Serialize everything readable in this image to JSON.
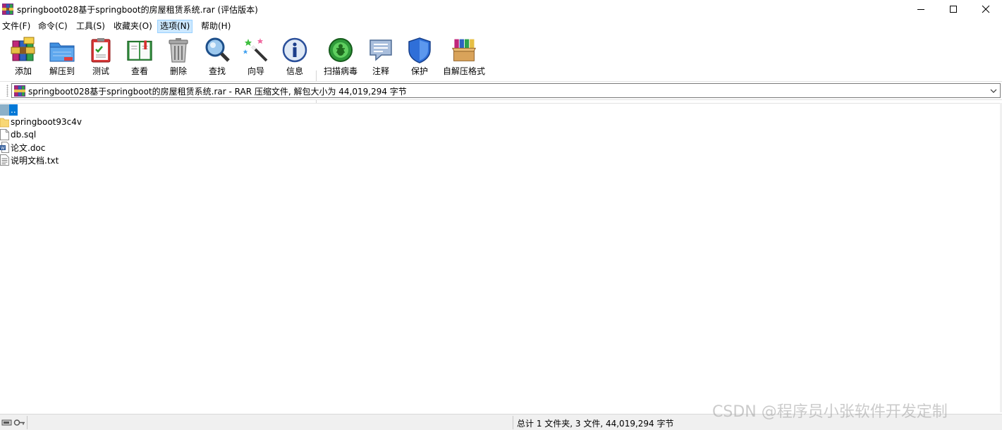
{
  "window": {
    "title": "springboot028基于springboot的房屋租赁系统.rar (评估版本)",
    "app_icon": "winrar-icon",
    "controls": [
      "minimize-icon",
      "maximize-icon",
      "close-icon"
    ]
  },
  "menu": [
    {
      "label": "文件(F)"
    },
    {
      "label": "命令(C)"
    },
    {
      "label": "工具(S)"
    },
    {
      "label": "收藏夹(O)"
    },
    {
      "label": "选项(N)",
      "active": true
    },
    {
      "label": "帮助(H)"
    }
  ],
  "toolbar": [
    {
      "label": "添加",
      "icon": "add-archive-icon"
    },
    {
      "label": "解压到",
      "icon": "extract-to-icon"
    },
    {
      "label": "测试",
      "icon": "test-icon"
    },
    {
      "label": "查看",
      "icon": "view-book-icon"
    },
    {
      "label": "删除",
      "icon": "delete-trash-icon"
    },
    {
      "label": "查找",
      "icon": "find-magnifier-icon"
    },
    {
      "label": "向导",
      "icon": "wizard-wand-icon"
    },
    {
      "label": "信息",
      "icon": "info-icon"
    },
    {
      "label": "扫描病毒",
      "icon": "scan-virus-icon"
    },
    {
      "label": "注释",
      "icon": "comment-icon"
    },
    {
      "label": "保护",
      "icon": "protect-shield-icon"
    },
    {
      "label": "自解压格式",
      "icon": "sfx-box-icon"
    }
  ],
  "address": {
    "text": "springboot028基于springboot的房屋租赁系统.rar - RAR 压缩文件, 解包大小为 44,019,294 字节"
  },
  "files": [
    {
      "name": "..",
      "type": "updir",
      "icon": "parent-folder-icon"
    },
    {
      "name": "springboot93c4v",
      "type": "folder",
      "icon": "folder-icon"
    },
    {
      "name": "db.sql",
      "type": "file",
      "icon": "file-icon"
    },
    {
      "name": "论文.doc",
      "type": "doc",
      "icon": "word-doc-icon"
    },
    {
      "name": "说明文档.txt",
      "type": "txt",
      "icon": "text-file-icon"
    }
  ],
  "status": {
    "summary": "总计 1 文件夹, 3 文件, 44,019,294 字节",
    "watermark": "CSDN @程序员小张软件开发定制"
  },
  "colors": {
    "selection": "#0078d7",
    "menu_active_bg": "#cce8ff",
    "statusbar_bg": "#f0f0f0"
  }
}
